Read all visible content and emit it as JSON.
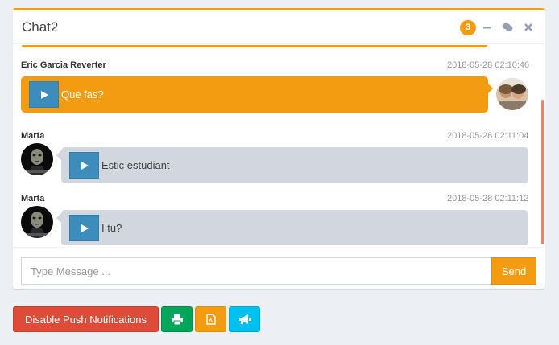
{
  "chat": {
    "title": "Chat2",
    "badge": "3",
    "messages": [
      {
        "name": "Eric Garcia Reverter",
        "time": "2018-05-28 02:10:46",
        "text": "Que fas?",
        "side": "right"
      },
      {
        "name": "Marta",
        "time": "2018-05-28 02:11:04",
        "text": "Estic estudiant",
        "side": "left"
      },
      {
        "name": "Marta",
        "time": "2018-05-28 02:11:12",
        "text": "I tu?",
        "side": "left"
      }
    ],
    "input_placeholder": "Type Message ...",
    "send_label": "Send"
  },
  "actions": {
    "disable_push_label": "Disable Push Notifications"
  },
  "colors": {
    "warning": "#f39c12",
    "primary": "#3c8dbc",
    "danger": "#dd4b39",
    "success": "#00a65a",
    "info": "#00c0ef"
  },
  "icons": {
    "minimize": "minus-icon",
    "contacts": "comments-icon",
    "close": "close-icon",
    "play": "play-icon",
    "print": "print-icon",
    "pdf": "file-pdf-icon",
    "announce": "bullhorn-icon"
  }
}
